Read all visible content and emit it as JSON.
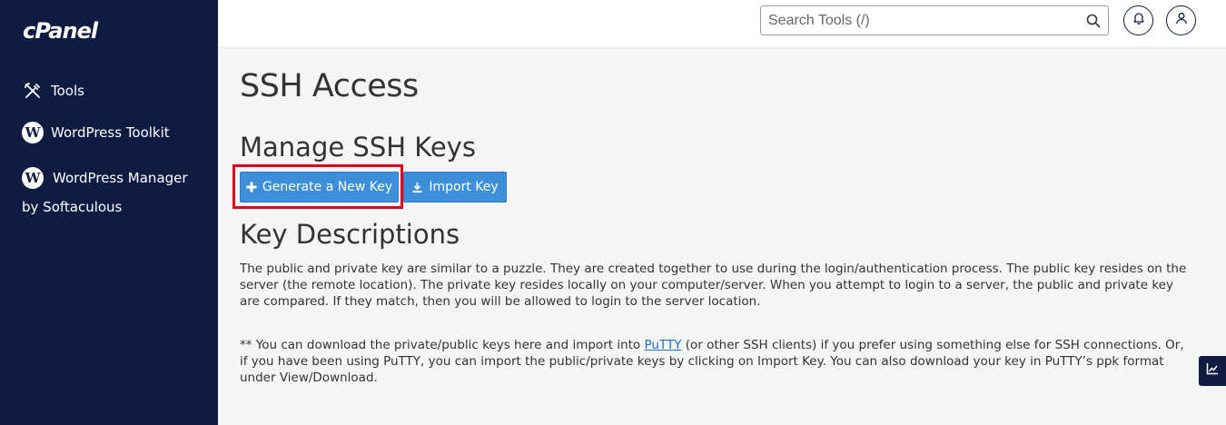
{
  "sidebar": {
    "logo": "cPanel",
    "items": [
      {
        "label": "Tools",
        "icon": "tools-icon"
      },
      {
        "label": "WordPress Toolkit",
        "icon": "wordpress-icon"
      },
      {
        "label_line1": "WordPress Manager",
        "label_line2": "by Softaculous",
        "icon": "wordpress-icon"
      }
    ]
  },
  "header": {
    "search_placeholder": "Search Tools (/)",
    "icons": [
      "search-icon",
      "bell-icon",
      "user-icon"
    ]
  },
  "main": {
    "page_title": "SSH Access",
    "manage_heading": "Manage SSH Keys",
    "generate_button": "Generate a New Key",
    "import_button": "Import Key",
    "descriptions_heading": "Key Descriptions",
    "paragraph1": "The public and private key are similar to a puzzle. They are created together to use during the login/authentication process. The public key resides on the server (the remote location). The private key resides locally on your computer/server. When you attempt to login to a server, the public and private key are compared. If they match, then you will be allowed to login to the server location.",
    "paragraph2_before": "** You can download the private/public keys here and import into ",
    "paragraph2_link": "PuTTY",
    "paragraph2_after": " (or other SSH clients) if you prefer using something else for SSH connections. Or, if you have been using PuTTY, you can import the public/private keys by clicking on Import Key. You can also download your key in PuTTY’s ppk format under View/Download."
  },
  "colors": {
    "sidebar_bg": "#0f1c42",
    "button_blue": "#3d8fd9",
    "highlight_red": "#e3001b"
  }
}
